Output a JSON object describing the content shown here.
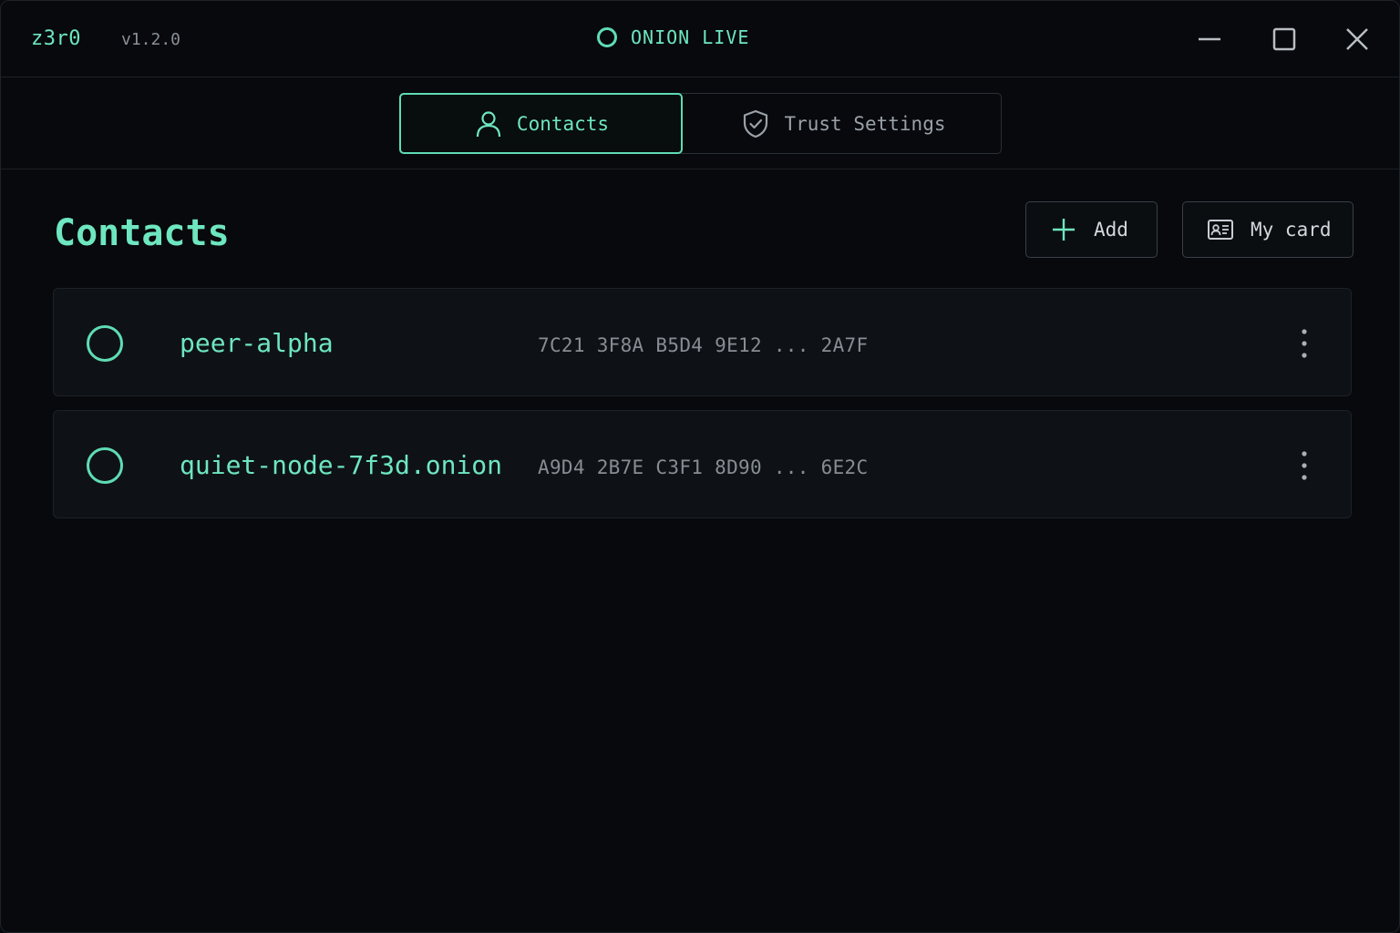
{
  "app": {
    "name": "z3r0",
    "version": "v1.2.0",
    "status": "ONION LIVE"
  },
  "window_controls": [
    "minimize-icon",
    "maximize-icon",
    "close-icon"
  ],
  "tabs": [
    {
      "label": "Contacts",
      "icon": "user-icon",
      "active": true
    },
    {
      "label": "Trust Settings",
      "icon": "shield-check-icon",
      "active": false
    }
  ],
  "main": {
    "title": "Contacts",
    "add_label": "Add",
    "my_card_label": "My card"
  },
  "contacts": [
    {
      "name": "peer-alpha",
      "fingerprint": "7C21 3F8A B5D4 9E12 ... 2A7F"
    },
    {
      "name": "quiet-node-7f3d.onion",
      "fingerprint": "A9D4 2B7E C3F1 8D90 ... 6E2C"
    }
  ],
  "colors": {
    "accent": "#6ee6bf",
    "background": "#07090c",
    "row_background": "#0e1216",
    "muted_text": "#878d94"
  }
}
